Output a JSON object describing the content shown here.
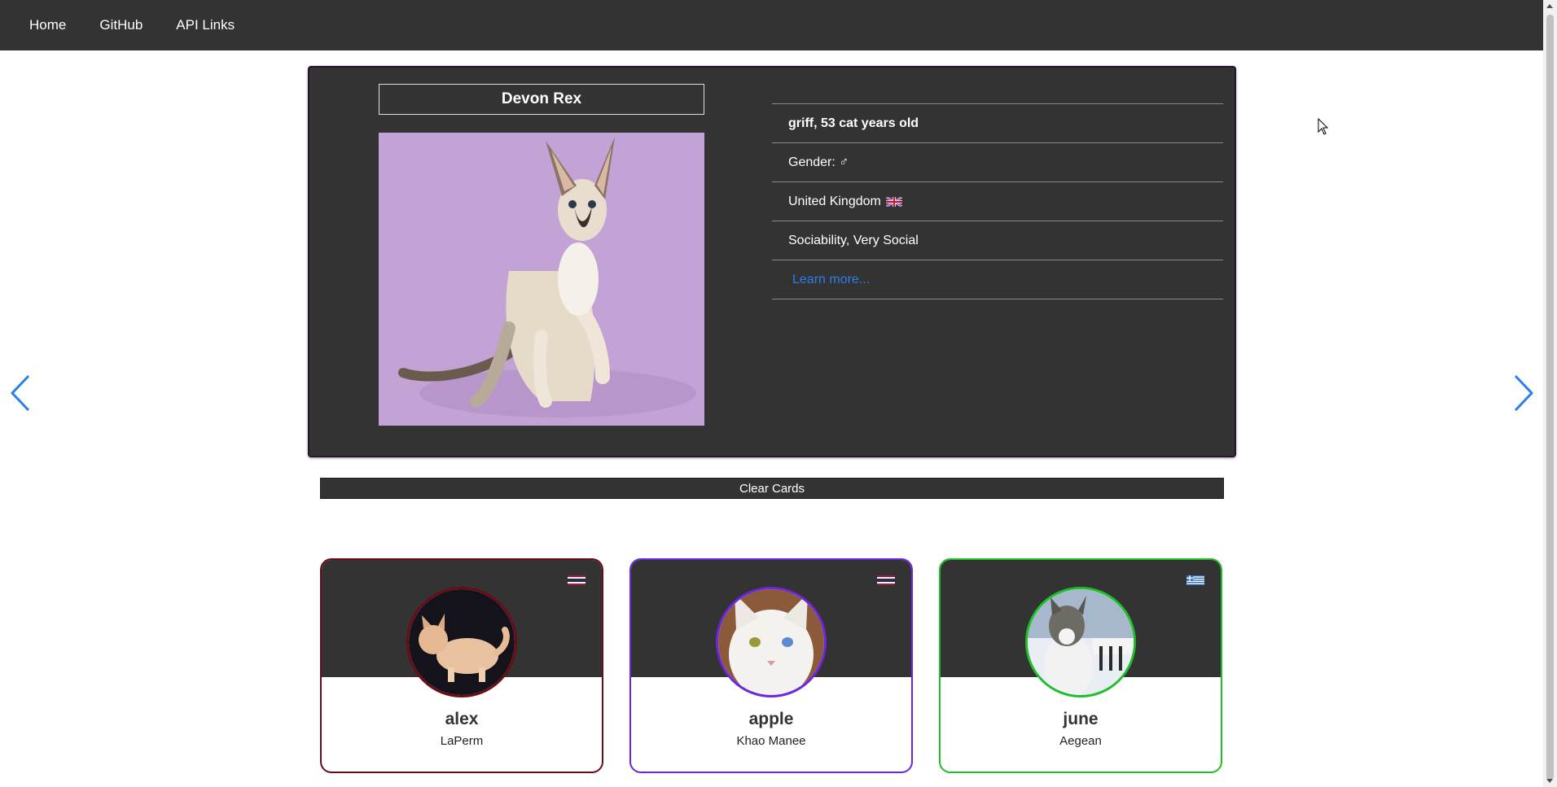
{
  "nav": {
    "items": [
      {
        "label": "Home"
      },
      {
        "label": "GitHub"
      },
      {
        "label": "API Links"
      }
    ]
  },
  "featured": {
    "breed": "Devon Rex",
    "name_age": "griff, 53 cat years old",
    "gender": "Gender: ♂",
    "origin": "United Kingdom",
    "origin_flag": "uk-flag-icon",
    "temperament": "Sociability, Very Social",
    "learn_more": "Learn more..."
  },
  "controls": {
    "clear_label": "Clear Cards",
    "prev_icon": "chevron-left-icon",
    "next_icon": "chevron-right-icon"
  },
  "cards": [
    {
      "name": "alex",
      "breed": "LaPerm",
      "border_color": "#6b0b17",
      "flag": "thailand-flag-icon"
    },
    {
      "name": "apple",
      "breed": "Khao Manee",
      "border_color": "#6a26e0",
      "flag": "thailand-flag-icon"
    },
    {
      "name": "june",
      "breed": "Aegean",
      "border_color": "#1fbf2a",
      "flag": "greece-flag-icon"
    }
  ],
  "colors": {
    "nav_bg": "#333333",
    "link_blue": "#2a7fe8",
    "card_dark": "#333333"
  }
}
